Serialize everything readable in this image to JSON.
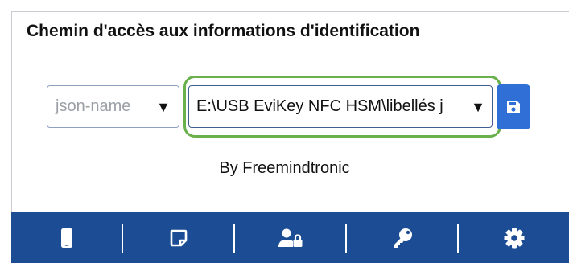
{
  "header": {
    "title": "Chemin d'accès aux informations d'identification"
  },
  "fields": {
    "name_select": {
      "value": "json-name"
    },
    "path_select": {
      "value": "E:\\USB EviKey NFC HSM\\libellés j"
    },
    "caret": "▼"
  },
  "save_button": {
    "icon": "floppy-disk-icon"
  },
  "footer": {
    "credit": "By Freemindtronic"
  },
  "navbar": {
    "items": [
      {
        "icon": "phone-icon"
      },
      {
        "icon": "note-icon"
      },
      {
        "icon": "user-lock-icon"
      },
      {
        "icon": "key-icon"
      },
      {
        "icon": "gear-icon"
      }
    ]
  },
  "colors": {
    "navbar": "#1b4c94",
    "save_button": "#2f6fd6",
    "highlight_outline": "#6ab04c",
    "placeholder_text": "#9aa0a6"
  }
}
